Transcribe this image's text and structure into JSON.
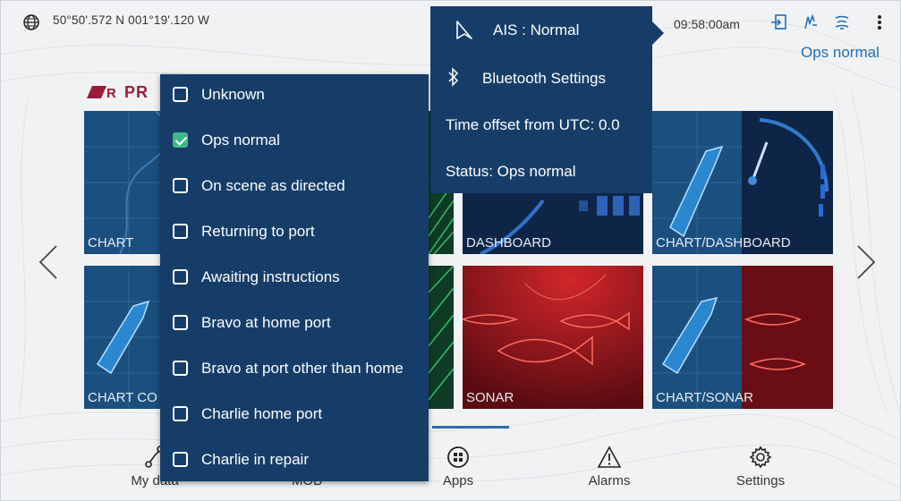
{
  "statusbar": {
    "coordinates": "50°50'.572 N   001°19'.120 W",
    "time": "09:58:00am",
    "ops_status": "Ops normal",
    "icons": [
      "globe-icon",
      "exit-icon",
      "waypoint-icon",
      "sonar-icon",
      "more-menu-icon"
    ]
  },
  "brand": {
    "logo_text": "PR"
  },
  "tiles": [
    {
      "label": "CHART"
    },
    {
      "label": "DASHBOARD"
    },
    {
      "label": "CHART/DASHBOARD"
    },
    {
      "label": "CHART CO"
    },
    {
      "label": "SONAR"
    },
    {
      "label": "CHART/SONAR"
    }
  ],
  "dock": [
    {
      "label": "My data",
      "icon": "mydata-icon"
    },
    {
      "label": "MOB",
      "icon": "mob-icon"
    },
    {
      "label": "Apps",
      "icon": "apps-icon"
    },
    {
      "label": "Alarms",
      "icon": "alarm-icon"
    },
    {
      "label": "Settings",
      "icon": "gear-icon"
    }
  ],
  "status_menu": {
    "items": [
      {
        "label": "Unknown",
        "checked": false
      },
      {
        "label": "Ops normal",
        "checked": true
      },
      {
        "label": "On scene as directed",
        "checked": false
      },
      {
        "label": "Returning to port",
        "checked": false
      },
      {
        "label": "Awaiting instructions",
        "checked": false
      },
      {
        "label": "Bravo at home port",
        "checked": false
      },
      {
        "label": "Bravo at port other than home",
        "checked": false
      },
      {
        "label": "Charlie home port",
        "checked": false
      },
      {
        "label": "Charlie in repair",
        "checked": false
      }
    ]
  },
  "settings_panel": {
    "ais": "AIS : Normal",
    "bluetooth": "Bluetooth Settings",
    "time_offset": "Time offset from UTC: 0.0",
    "status": "Status: Ops normal"
  },
  "colors": {
    "panel": "#163d68",
    "accent": "#1f6fb3",
    "check": "#3dba86",
    "brand": "#9b1b3a"
  }
}
